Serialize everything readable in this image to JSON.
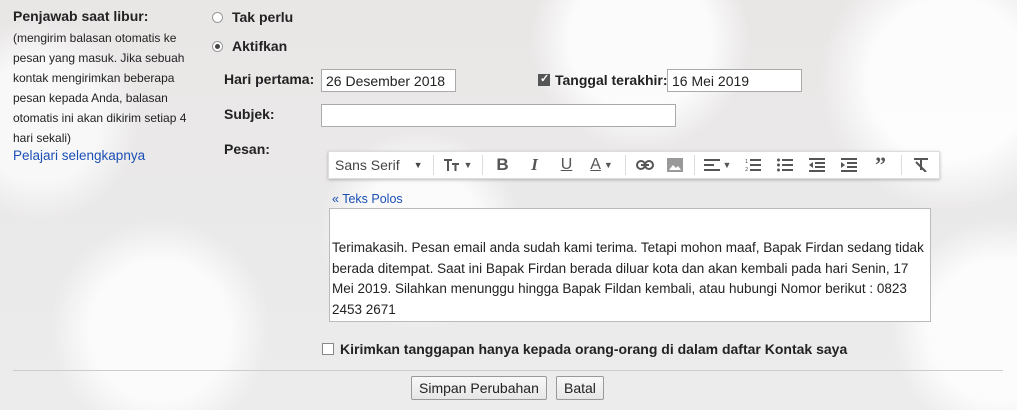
{
  "section": {
    "title": "Penjawab saat libur:",
    "description": "(mengirim balasan otomatis ke pesan yang masuk. Jika sebuah kontak mengirimkan beberapa pesan kepada Anda, balasan otomatis ini akan dikirim setiap 4 hari sekali)",
    "learn_more": "Pelajari selengkapnya"
  },
  "options": {
    "off_label": "Tak perlu",
    "on_label": "Aktifkan",
    "selected": "on"
  },
  "fields": {
    "first_day_label": "Hari pertama:",
    "first_day_value": "26 Desember 2018",
    "last_day_label": "Tanggal terakhir:",
    "last_day_checked": true,
    "last_day_value": "16 Mei 2019",
    "subject_label": "Subjek:",
    "subject_value": "",
    "message_label": "Pesan:"
  },
  "toolbar": {
    "font_name": "Sans Serif",
    "icons": [
      "font-size-icon",
      "bold-icon",
      "italic-icon",
      "underline-icon",
      "text-color-icon",
      "link-icon",
      "image-icon",
      "align-icon",
      "numbered-list-icon",
      "bulleted-list-icon",
      "indent-less-icon",
      "indent-more-icon",
      "quote-icon",
      "remove-formatting-icon"
    ]
  },
  "editor": {
    "plain_text_link": "« Teks Polos",
    "body": "Terimakasih. Pesan email anda sudah kami terima. Tetapi mohon maaf, Bapak Firdan sedang tidak berada ditempat. Saat ini Bapak Firdan berada diluar kota dan akan kembali pada hari Senin, 17 Mei 2019. Silahkan menunggu hingga Bapak Fildan kembali, atau hubungi Nomor berikut : 0823 2453 2671"
  },
  "contacts_only": {
    "label": "Kirimkan tanggapan hanya kepada orang-orang di dalam daftar Kontak saya",
    "checked": false
  },
  "actions": {
    "save_label": "Simpan Perubahan",
    "cancel_label": "Batal"
  }
}
